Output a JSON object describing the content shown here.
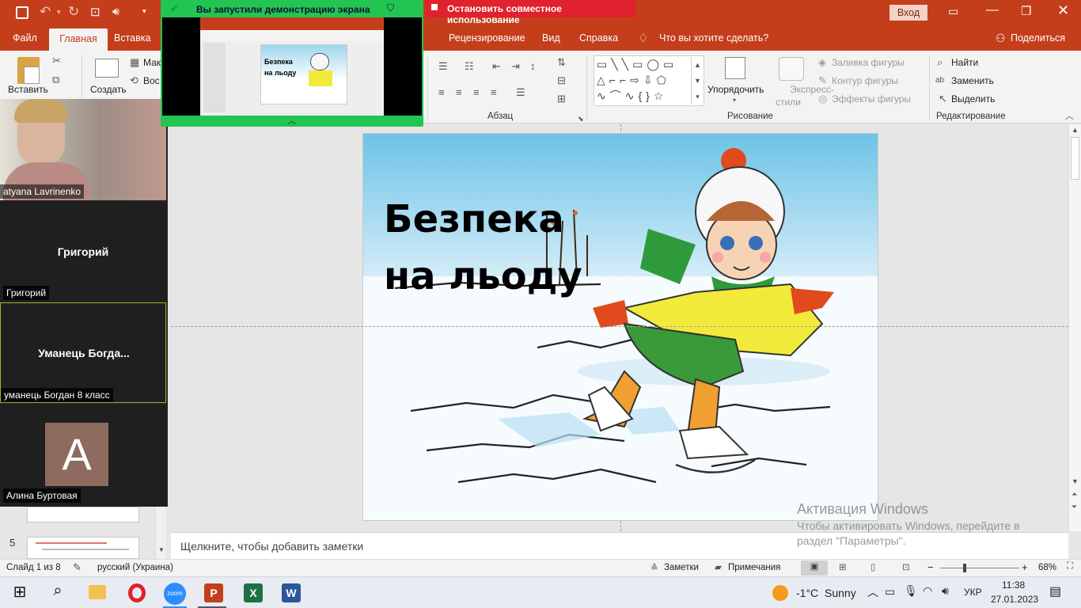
{
  "titlebar": {
    "login_button": "Вход"
  },
  "ribbon_tabs": {
    "file": "Файл",
    "home": "Главная",
    "insert": "Вставка",
    "review": "Рецензирование",
    "view": "Вид",
    "help": "Справка",
    "tell_me": "Что вы хотите сделать?",
    "share": "Поделиться"
  },
  "ribbon": {
    "paste": "Вставить",
    "create": "Создать",
    "layout_partial": "Мак",
    "reset_partial": "Вос",
    "paragraph_group": "Абзац",
    "drawing_group": "Рисование",
    "editing_group": "Редактирование",
    "arrange": "Упорядочить",
    "quick_styles_1": "Экспресс-",
    "quick_styles_2": "стили",
    "shape_fill": "Заливка фигуры",
    "shape_outline": "Контур фигуры",
    "shape_effects": "Эффекты фигуры",
    "find": "Найти",
    "replace": "Заменить",
    "select": "Выделить"
  },
  "zoom": {
    "share_banner": "Вы запустили демонстрацию экрана",
    "stop_share": "Остановить совместное использование",
    "participants": [
      {
        "display": "",
        "label": "atyana Lavrinenko"
      },
      {
        "display": "Григорий",
        "label": "Григорий"
      },
      {
        "display": "Уманець  Богда...",
        "label": "уманець Богдан 8 класс"
      },
      {
        "display": "A",
        "label": "Алина Буртовая"
      }
    ]
  },
  "thumbnails": {
    "slide5_number": "5"
  },
  "slide": {
    "title_line1": "Безпека",
    "title_line2": "на льоду"
  },
  "preview": {
    "title_line1": "Безпека",
    "title_line2": "на льоду"
  },
  "notes": {
    "placeholder": "Щелкните, чтобы добавить заметки"
  },
  "watermark": {
    "line1": "Активация Windows",
    "line2": "Чтобы активировать Windows, перейдите в",
    "line3": "раздел \"Параметры\"."
  },
  "statusbar": {
    "slide_info": "Слайд 1 из 8",
    "language": "русский (Украина)",
    "notes": "Заметки",
    "comments": "Примечания",
    "zoom_minus": "−",
    "zoom_plus": "+",
    "zoom_level": "68%"
  },
  "taskbar": {
    "zoom_app": "zoom",
    "temperature": "-1°C",
    "weather": "Sunny",
    "lang": "УКР",
    "time": "11:38",
    "date": "27.01.2023"
  },
  "colors": {
    "accent": "#c43e1c",
    "zoom_green": "#23c552",
    "stop_red": "#e0212e",
    "avatar_bg": "#8d6b5e"
  }
}
